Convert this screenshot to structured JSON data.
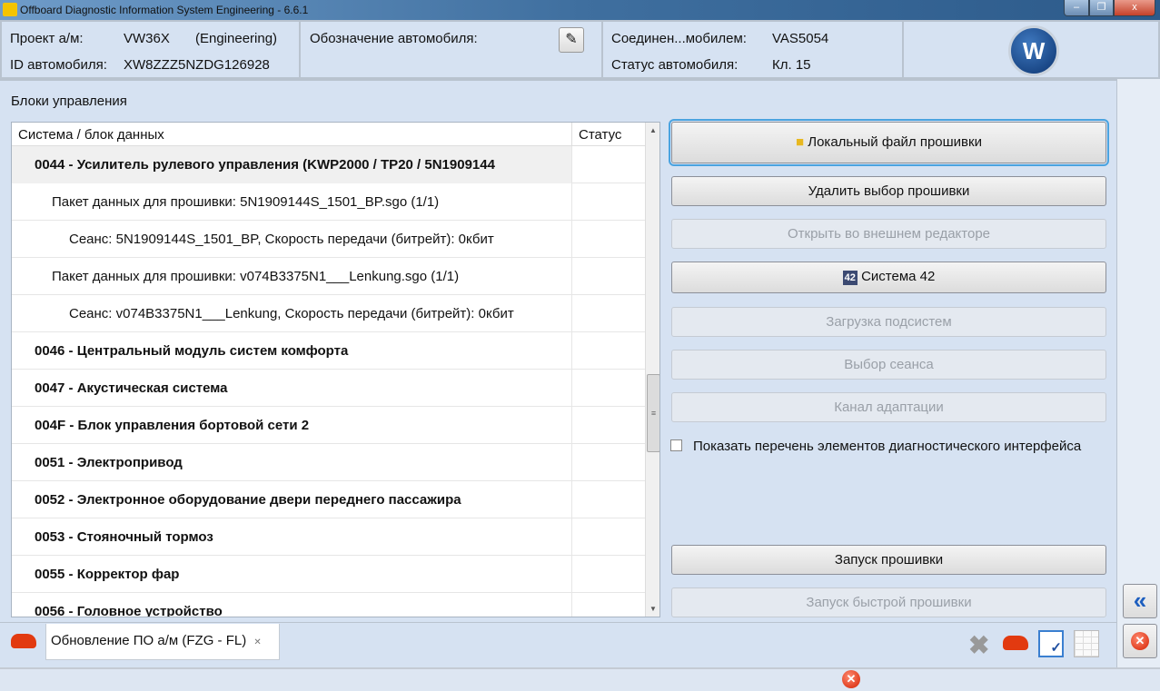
{
  "window": {
    "title": "Offboard Diagnostic Information System Engineering - 6.6.1",
    "min": "–",
    "restore": "❐",
    "close": "x"
  },
  "header": {
    "project_label": "Проект а/м:",
    "project_value": "VW36X",
    "project_mode": "(Engineering)",
    "vin_label": "ID автомобиля:",
    "vin_value": "XW8ZZZ5NZDG126928",
    "designation_label": "Обозначение автомобиля:",
    "connection_label": "Соединен...мобилем:",
    "connection_value": "VAS5054",
    "status_label": "Статус автомобиля:",
    "status_value": "Кл. 15",
    "logo": "VW"
  },
  "main": {
    "section_title": "Блоки управления",
    "table": {
      "col_system": "Система / блок данных",
      "col_status": "Статус",
      "rows": [
        {
          "text": "0044 - Усилитель рулевого управления  (KWP2000 / TP20 / 5N1909144",
          "level": 0
        },
        {
          "text": "Пакет данных для прошивки: 5N1909144S_1501_BP.sgo (1/1)",
          "level": 1
        },
        {
          "text": "Сеанс: 5N1909144S_1501_BP, Скорость передачи (битрейт): 0кбит",
          "level": 2
        },
        {
          "text": "Пакет данных для прошивки: v074B3375N1___Lenkung.sgo (1/1)",
          "level": 1
        },
        {
          "text": "Сеанс: v074B3375N1___Lenkung, Скорость передачи (битрейт): 0кбит",
          "level": 2
        },
        {
          "text": "0046 - Центральный модуль систем комфорта",
          "level": 0
        },
        {
          "text": "0047 - Акустическая система",
          "level": 0
        },
        {
          "text": "004F - Блок управления бортовой сети 2",
          "level": 0
        },
        {
          "text": "0051 - Электропривод",
          "level": 0
        },
        {
          "text": "0052 - Электронное оборудование двери переднего пассажира",
          "level": 0
        },
        {
          "text": "0053 - Стояночный тормоз",
          "level": 0
        },
        {
          "text": "0055 - Корректор фар",
          "level": 0
        },
        {
          "text": "0056 - Головное устройство",
          "level": 0
        }
      ]
    },
    "buttons": {
      "local_file": "Локальный файл прошивки",
      "delete_selection": "Удалить выбор прошивки",
      "open_editor": "Открыть во внешнем редакторе",
      "system42": "Система 42",
      "load_subsystems": "Загрузка подсистем",
      "select_session": "Выбор сеанса",
      "adaptation": "Канал адаптации",
      "start_flash": "Запуск прошивки",
      "start_fast_flash": "Запуск быстрой прошивки"
    },
    "checkbox_label": "Показать перечень элементов диагностического интерфейса",
    "checkbox_checked": false
  },
  "tabs": {
    "active": "Обновление ПО а/м (FZG - FL)",
    "close": "✕"
  }
}
